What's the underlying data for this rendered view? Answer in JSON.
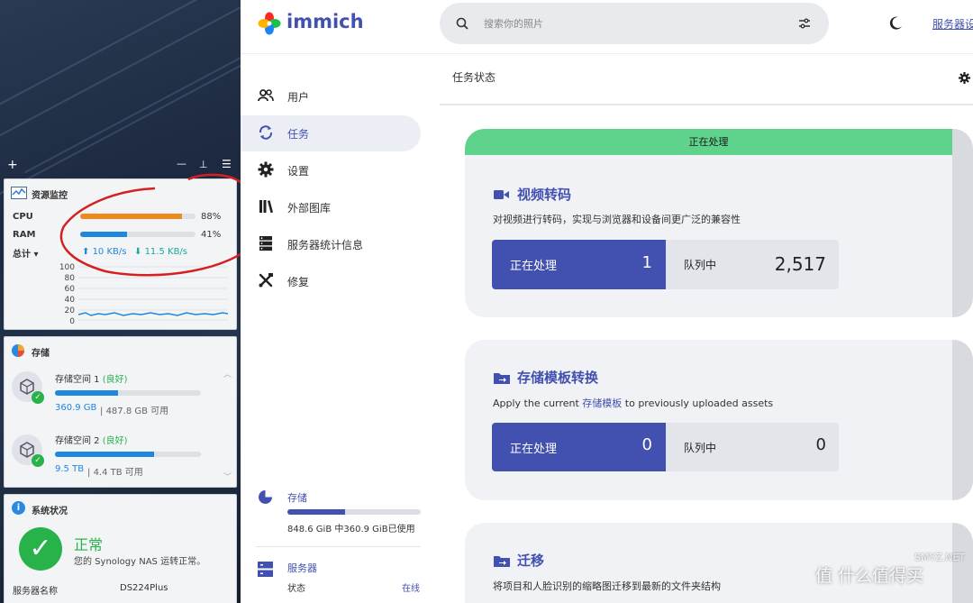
{
  "desktop": {
    "toolbar": {
      "add": "+",
      "minimize": "—",
      "pin": "📌",
      "menu": "☰"
    },
    "resource": {
      "title": "资源监控",
      "cpu_label": "CPU",
      "cpu_pct": "88%",
      "cpu_value": 0.88,
      "ram_label": "RAM",
      "ram_pct": "41%",
      "ram_value": 0.41,
      "total_label": "总计 ▾",
      "upload": "10 KB/s",
      "download": "11.5 KB/s",
      "chart_ticks": [
        "100",
        "80",
        "60",
        "40",
        "20",
        "0"
      ]
    },
    "storage": {
      "title": "存储",
      "volumes": [
        {
          "name": "存储空间 1",
          "status": "(良好)",
          "used": "360.9 GB",
          "total": "487.8 GB 可用",
          "fill": 0.43
        },
        {
          "name": "存储空间 2",
          "status": "(良好)",
          "used": "9.5 TB",
          "total": "4.4 TB 可用",
          "fill": 0.68
        }
      ]
    },
    "system": {
      "title": "系统状况",
      "status": "正常",
      "desc": "您的 Synology NAS 运转正常。",
      "server_name_label": "服务器名称",
      "server_name": "DS224Plus"
    }
  },
  "app": {
    "logo": "immich",
    "search_placeholder": "搜索你的照片",
    "server_link": "服务器设",
    "nav": [
      {
        "label": "用户",
        "icon": "users-icon"
      },
      {
        "label": "任务",
        "icon": "sync-icon"
      },
      {
        "label": "设置",
        "icon": "gear-icon"
      },
      {
        "label": "外部图库",
        "icon": "library-icon"
      },
      {
        "label": "服务器统计信息",
        "icon": "server-icon"
      },
      {
        "label": "修复",
        "icon": "tools-icon"
      }
    ],
    "storage": {
      "label": "存储",
      "usage": "848.6 GiB 中360.9 GiB已使用",
      "fill": 0.43
    },
    "server": {
      "label": "服务器",
      "status_label": "状态",
      "status_value": "在线"
    },
    "page_title": "任务状态",
    "jobs": [
      {
        "title": "视频转码",
        "desc": "对视频进行转码，实现与浏览器和设备间更广泛的兼容性",
        "banner": "正在处理",
        "active_label": "正在处理",
        "active": "1",
        "waiting_label": "队列中",
        "waiting": "2,517"
      },
      {
        "title": "存储模板转换",
        "desc_pre": "Apply the current ",
        "desc_link": "存储模板",
        "desc_post": " to previously uploaded assets",
        "active_label": "正在处理",
        "active": "0",
        "waiting_label": "队列中",
        "waiting": "0"
      },
      {
        "title": "迁移",
        "desc": "将项目和人脸识别的缩略图迁移到最新的文件夹结构"
      }
    ],
    "watermark": "值 什么值得买",
    "watermark2": "SMYZ.NET"
  },
  "colors": {
    "accent": "#4250af",
    "green_banner": "#5fd38b",
    "ok_green": "#27b24a"
  }
}
